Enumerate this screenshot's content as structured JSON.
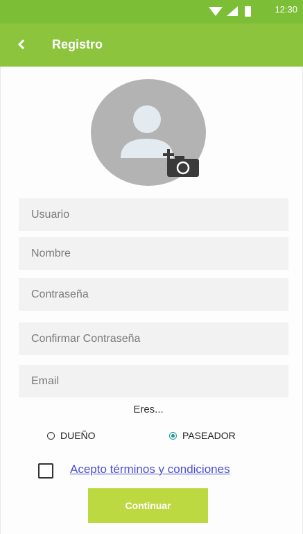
{
  "status_bar": {
    "time": "12:30"
  },
  "header": {
    "title": "Registro"
  },
  "form": {
    "usuario_placeholder": "Usuario",
    "nombre_placeholder": "Nombre",
    "contrasena_placeholder": "Contraseña",
    "confirmar_placeholder": "Confirmar Contraseña",
    "email_placeholder": "Email"
  },
  "role": {
    "question": "Eres...",
    "options": [
      "DUEÑO",
      "PASEADOR"
    ],
    "selected": "PASEADOR"
  },
  "terms": {
    "label": "Acepto términos y condiciones",
    "checked": false
  },
  "actions": {
    "continue_label": "Continuar"
  },
  "colors": {
    "status_bar": "#7cbf36",
    "app_bar": "#8cc43e",
    "button": "#bdd942",
    "link": "#4a4fd0"
  }
}
